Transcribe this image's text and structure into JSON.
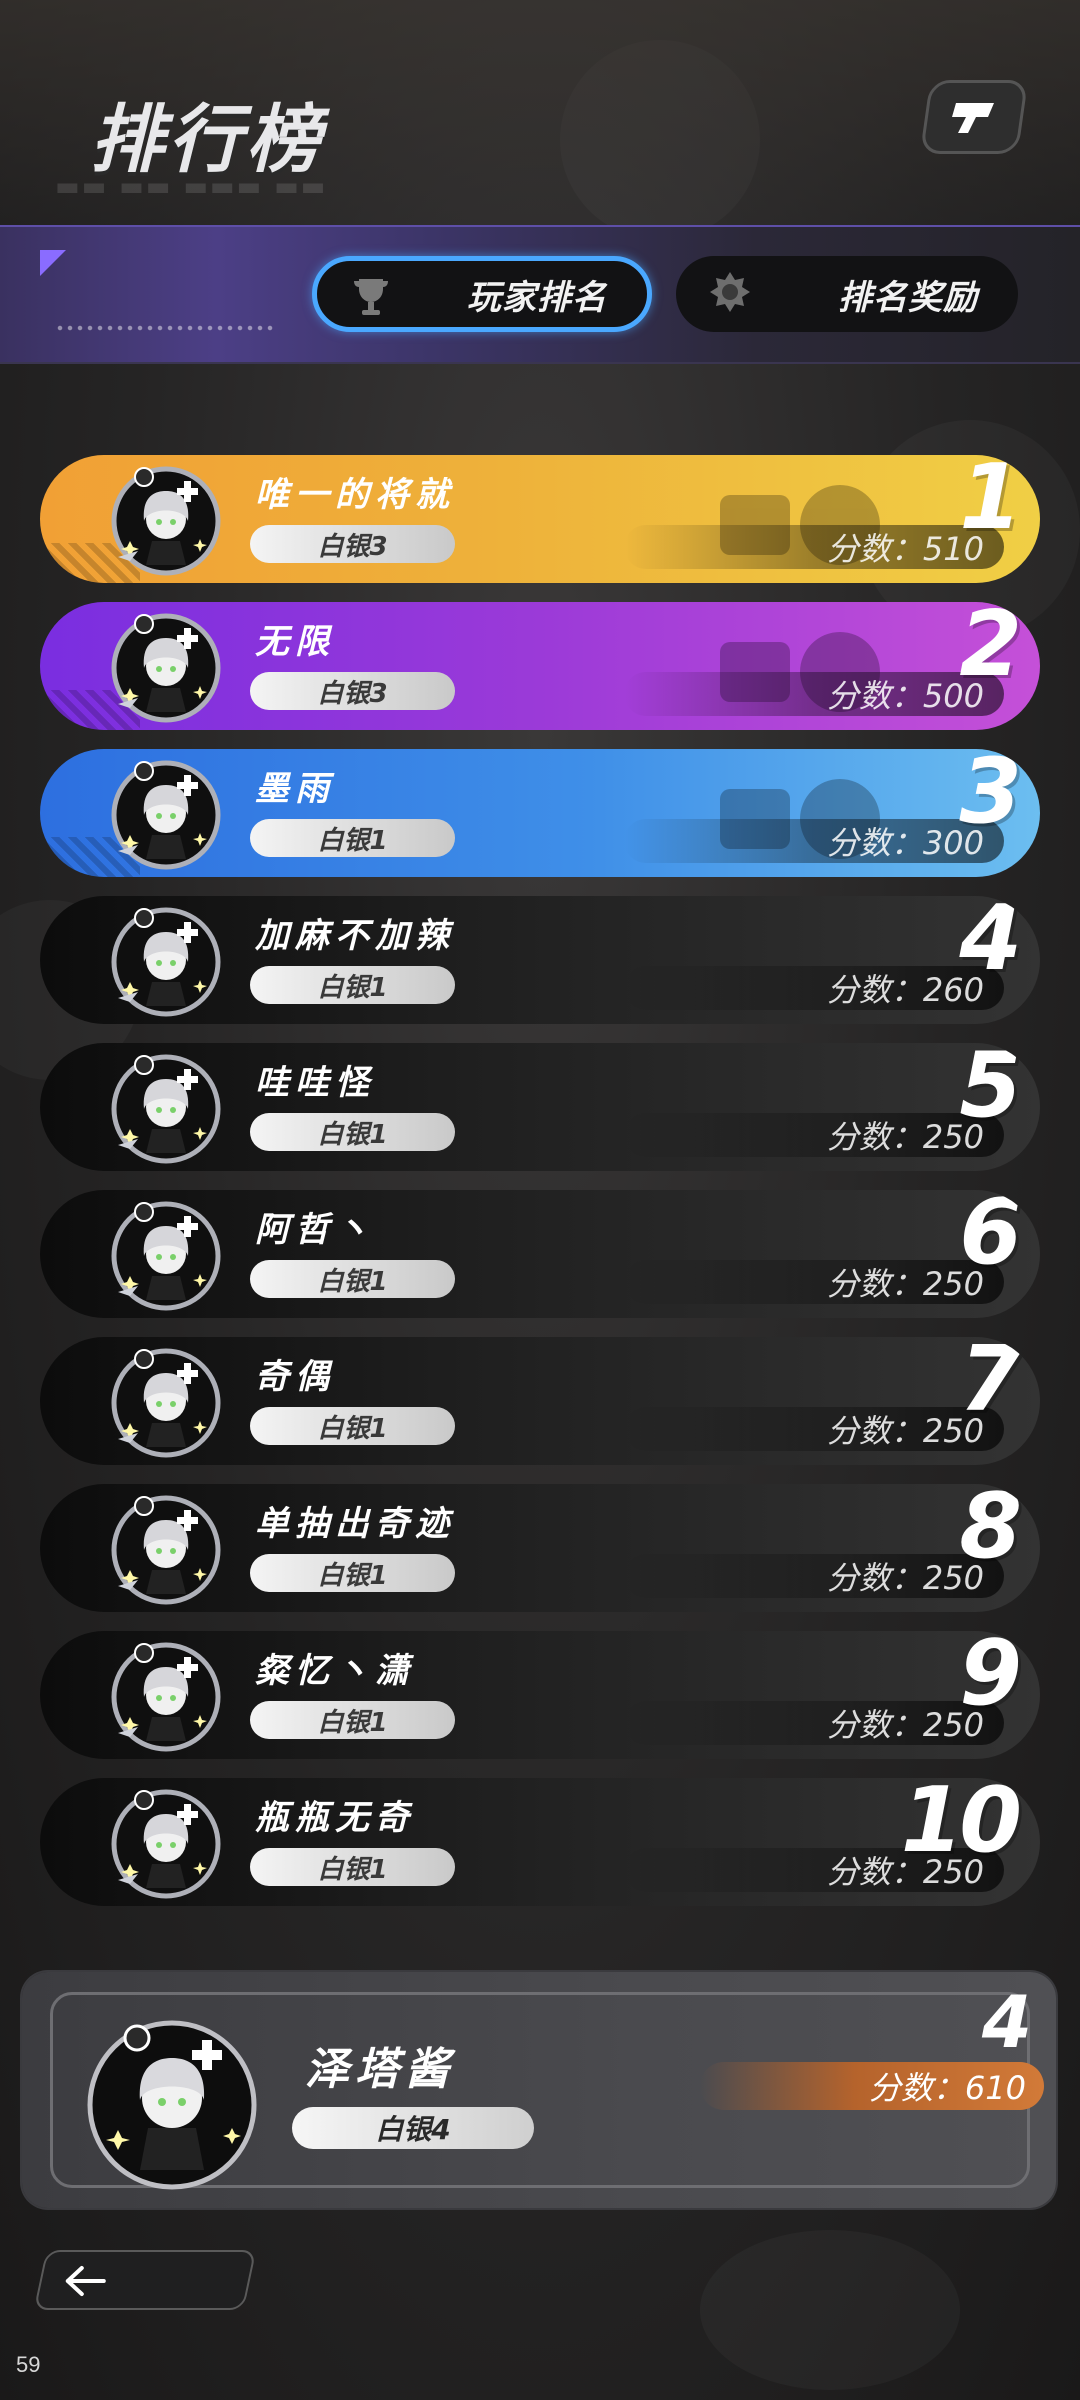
{
  "header": {
    "title": "排行榜",
    "help_icon": "help-icon"
  },
  "tabs": [
    {
      "label": "玩家排名",
      "icon": "trophy-icon",
      "active": true
    },
    {
      "label": "排名奖励",
      "icon": "medal-icon",
      "active": false
    }
  ],
  "score_prefix": "分数：",
  "leaderboard": [
    {
      "rank": "1",
      "name": "唯一的将就",
      "tier": "白银3",
      "score": "分数：510",
      "style": "gold"
    },
    {
      "rank": "2",
      "name": "无限",
      "tier": "白银3",
      "score": "分数：500",
      "style": "purple"
    },
    {
      "rank": "3",
      "name": "墨雨",
      "tier": "白银1",
      "score": "分数：300",
      "style": "blue"
    },
    {
      "rank": "4",
      "name": "加麻不加辣",
      "tier": "白银1",
      "score": "分数：260",
      "style": "dark"
    },
    {
      "rank": "5",
      "name": "哇哇怪",
      "tier": "白银1",
      "score": "分数：250",
      "style": "dark"
    },
    {
      "rank": "6",
      "name": "阿哲丶",
      "tier": "白银1",
      "score": "分数：250",
      "style": "dark"
    },
    {
      "rank": "7",
      "name": "奇偶",
      "tier": "白银1",
      "score": "分数：250",
      "style": "dark"
    },
    {
      "rank": "8",
      "name": "单抽出奇迹",
      "tier": "白银1",
      "score": "分数：250",
      "style": "dark"
    },
    {
      "rank": "9",
      "name": "粲忆丶潇",
      "tier": "白银1",
      "score": "分数：250",
      "style": "dark"
    },
    {
      "rank": "10",
      "name": "瓶瓶无奇",
      "tier": "白银1",
      "score": "分数：250",
      "style": "dark"
    }
  ],
  "self": {
    "rank": "4",
    "name": "泽塔酱",
    "tier": "白银4",
    "score": "分数：610"
  },
  "footer": {
    "back_icon": "back-arrow-icon",
    "fps": "59"
  },
  "colors": {
    "active_tab_border": "#4aa8ff",
    "gold": "#f0b63a",
    "purple": "#9b3ad8",
    "blue": "#3f8fe8",
    "self_score": "#d27a38"
  }
}
